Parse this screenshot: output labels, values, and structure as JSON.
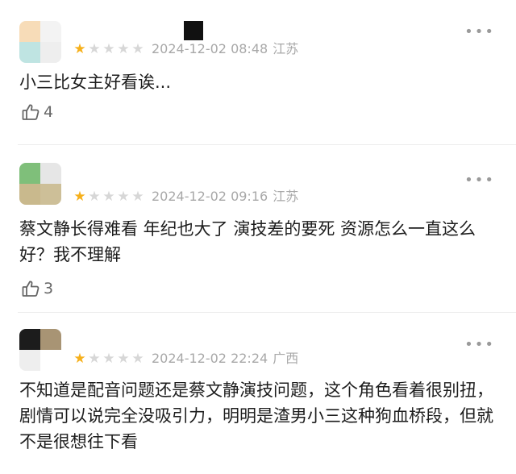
{
  "comments": [
    {
      "avatar_colors": [
        "#f7dcb8",
        "#f3f3f3",
        "#bfe4e2",
        "#eeeeee"
      ],
      "rating": 1,
      "max_rating": 5,
      "date": "2024-12-02 08:48",
      "region": "江苏",
      "text": "小三比女主好看诶...",
      "likes": "4"
    },
    {
      "avatar_colors": [
        "#7fbf7a",
        "#e6e6e6",
        "#c9b98d",
        "#cdbf98"
      ],
      "rating": 1,
      "max_rating": 5,
      "date": "2024-12-02 09:16",
      "region": "江苏",
      "text": "蔡文静长得难看 年纪也大了 演技差的要死 资源怎么一直这么好？我不理解",
      "likes": "3"
    },
    {
      "avatar_colors": [
        "#1c1c1c",
        "#a89474",
        "#eeeeee",
        "#ffffff"
      ],
      "rating": 1,
      "max_rating": 5,
      "date": "2024-12-02 22:24",
      "region": "广西",
      "text": "不知道是配音问题还是蔡文静演技问题，这个角色看着很别扭，剧情可以说完全没吸引力，明明是渣男小三这种狗血桥段，但就不是很想往下看",
      "likes": ""
    }
  ],
  "icons": {
    "more": "more-dots-icon",
    "like": "thumbs-up-icon",
    "star": "star-icon"
  },
  "colors": {
    "star_on": "#f6b01b",
    "star_off": "#d7d7d7",
    "meta_text": "#a8a8a8",
    "body_text": "#1d1d1d"
  }
}
